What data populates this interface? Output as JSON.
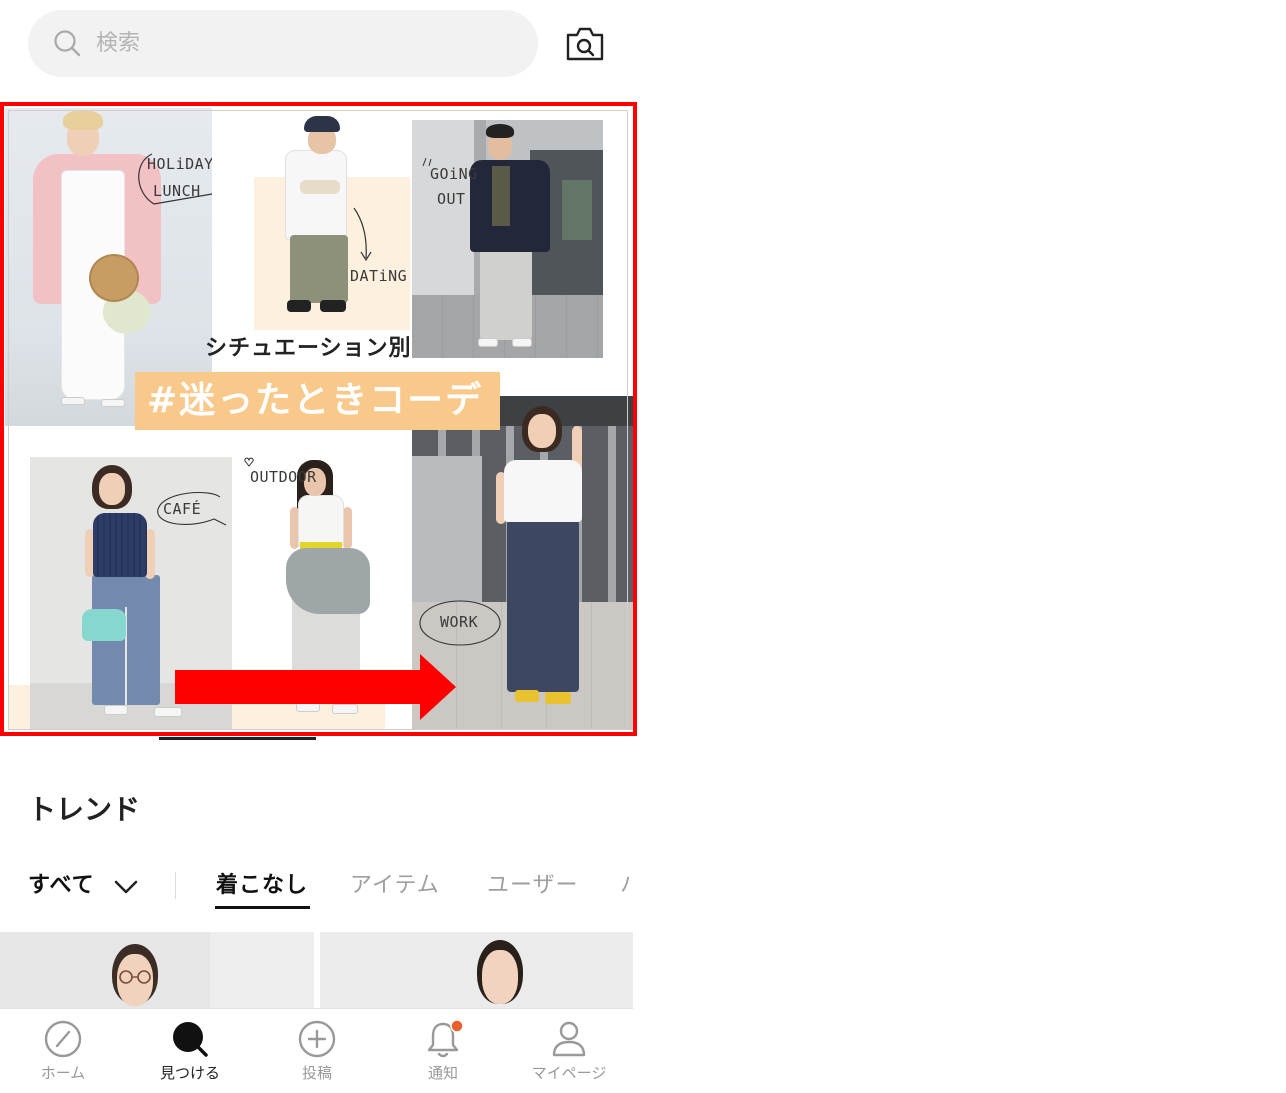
{
  "search": {
    "placeholder": "検索",
    "icon": "search-icon",
    "camera_icon": "camera-search-icon"
  },
  "banner": {
    "subtitle": "シチュエーション別",
    "title": "#迷ったときコーデ",
    "labels": {
      "holiday_lunch": [
        "HOLiDAY",
        "LUNCH"
      ],
      "dating": "DATiNG",
      "going_out": [
        "GOiNG",
        "OUT"
      ],
      "cafe": "CAFÉ",
      "outdoor": "OUTDOOR",
      "work": "WORK"
    },
    "title_bg_color": "#f9c88b",
    "highlight_color": "#ff0000"
  },
  "trend": {
    "heading": "トレンド",
    "filter_label": "すべて",
    "filter_icon": "chevron-down-icon",
    "tabs": [
      {
        "label": "着こなし",
        "active": true
      },
      {
        "label": "アイテム",
        "active": false
      },
      {
        "label": "ユーザー",
        "active": false
      },
      {
        "label": "ハ",
        "active": false
      }
    ]
  },
  "nav": {
    "items": [
      {
        "label": "ホーム",
        "icon": "compass-icon",
        "active": false
      },
      {
        "label": "見つける",
        "icon": "search-icon",
        "active": true
      },
      {
        "label": "投稿",
        "icon": "plus-circle-icon",
        "active": false
      },
      {
        "label": "通知",
        "icon": "bell-icon",
        "active": false,
        "badge": true
      },
      {
        "label": "マイページ",
        "icon": "user-icon",
        "active": false
      }
    ],
    "badge_color": "#e8602c",
    "active_color": "#222222",
    "inactive_color": "#999999"
  }
}
